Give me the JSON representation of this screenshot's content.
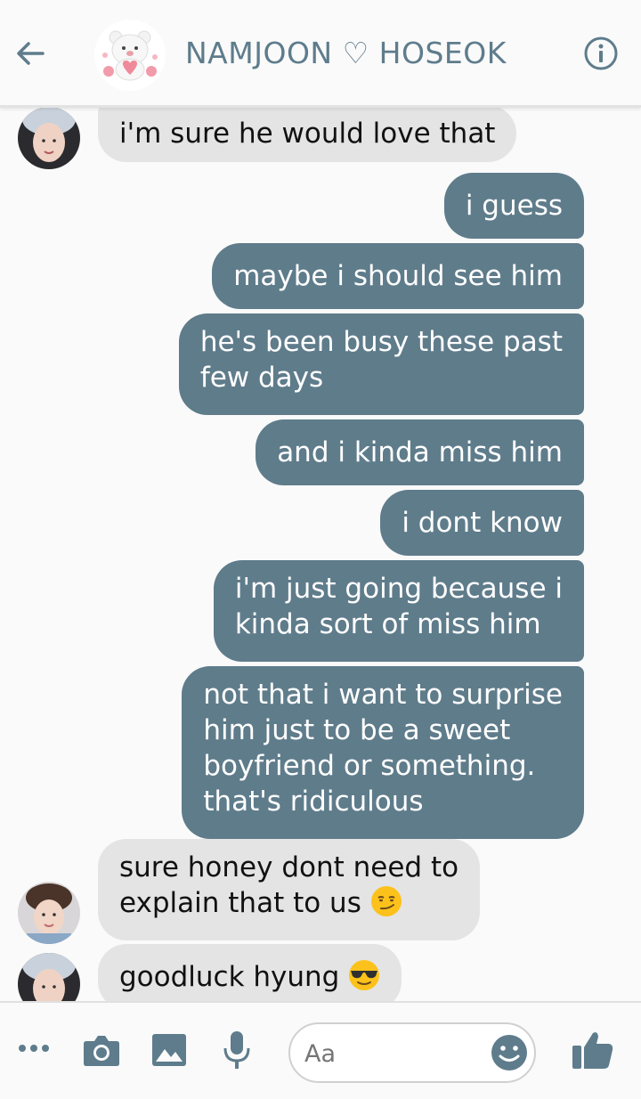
{
  "header": {
    "title": "NAMJOON ♡ HOSEOK",
    "back_icon": "arrow-left-icon",
    "info_icon": "info-circle-icon",
    "group_avatar": "bear-sticker"
  },
  "messages": [
    {
      "from": "namjoon",
      "text": "i'm sure he would love that"
    },
    {
      "from": "me",
      "text": "i guess"
    },
    {
      "from": "me",
      "text": "maybe i should see him"
    },
    {
      "from": "me",
      "lines": [
        "he's been busy these past",
        "few days"
      ]
    },
    {
      "from": "me",
      "text": "and i kinda miss him"
    },
    {
      "from": "me",
      "text": "i dont know"
    },
    {
      "from": "me",
      "lines": [
        "i'm just going because i",
        "kinda sort of miss him"
      ]
    },
    {
      "from": "me",
      "lines": [
        "not that i want to surprise",
        "him just to be a sweet",
        "boyfriend or something.",
        "that's ridiculous"
      ]
    },
    {
      "from": "hoseok",
      "lines": [
        "sure honey dont need to",
        "explain that to us"
      ],
      "emoji": "smirk-emoji"
    },
    {
      "from": "namjoon",
      "text": "goodluck hyung",
      "emoji": "sunglasses-emoji"
    }
  ],
  "composer": {
    "placeholder": "Aa",
    "icons": [
      "more-icon",
      "camera-icon",
      "image-icon",
      "microphone-icon",
      "emoji-icon",
      "thumbs-up-icon"
    ]
  },
  "colors": {
    "accent": "#5f7c8b",
    "incoming_bubble": "#e4e4e4",
    "background": "#fafafa"
  }
}
